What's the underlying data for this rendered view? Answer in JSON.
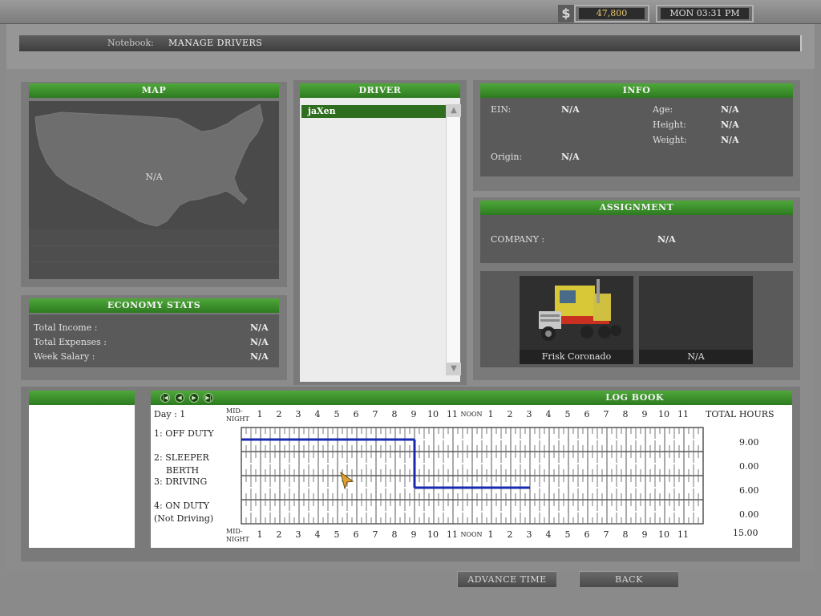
{
  "status": {
    "currency_symbol": "$",
    "money": "47,800",
    "clock": "MON 03:31 PM"
  },
  "header": {
    "label": "Notebook:",
    "title": "MANAGE DRIVERS"
  },
  "map": {
    "title": "MAP",
    "location": "N/A"
  },
  "driver": {
    "title": "DRIVER",
    "items": [
      "jaXen"
    ]
  },
  "info": {
    "title": "INFO",
    "ein_label": "EIN:",
    "ein": "N/A",
    "origin_label": "Origin:",
    "origin": "N/A",
    "age_label": "Age:",
    "age": "N/A",
    "height_label": "Height:",
    "height": "N/A",
    "weight_label": "Weight:",
    "weight": "N/A"
  },
  "assignment": {
    "title": "ASSIGNMENT",
    "company_label": "COMPANY :",
    "company": "N/A",
    "truck_name": "Frisk Coronado",
    "trailer_name": "N/A"
  },
  "economy": {
    "title": "ECONOMY STATS",
    "income_label": "Total Income :",
    "income": "N/A",
    "expenses_label": "Total Expenses :",
    "expenses": "N/A",
    "salary_label": "Week Salary :",
    "salary": "N/A"
  },
  "logbook": {
    "title": "LOG BOOK",
    "day": "Day : 1",
    "midnight_top": "MID-",
    "midnight_bottom": "NIGHT",
    "noon": "NOON",
    "total_hours_label": "TOTAL HOURS",
    "hour_labels": [
      "1",
      "2",
      "3",
      "4",
      "5",
      "6",
      "7",
      "8",
      "9",
      "10",
      "11",
      "NOON",
      "1",
      "2",
      "3",
      "4",
      "5",
      "6",
      "7",
      "8",
      "9",
      "10",
      "11"
    ],
    "rows": [
      {
        "label1": "1: OFF DUTY",
        "label2": "",
        "hours": "9.00"
      },
      {
        "label1": "2: SLEEPER",
        "label2": "BERTH",
        "hours": "0.00"
      },
      {
        "label1": "3: DRIVING",
        "label2": "",
        "hours": "6.00"
      },
      {
        "label1": "4: ON DUTY",
        "label2": "(Not Driving)",
        "hours": "0.00"
      }
    ],
    "total": "15.00",
    "segments": [
      {
        "row": 0,
        "start": 0,
        "end": 9
      },
      {
        "row": 2,
        "start": 9,
        "end": 15
      }
    ]
  },
  "buttons": {
    "advance": "ADVANCE TIME",
    "back": "BACK"
  }
}
